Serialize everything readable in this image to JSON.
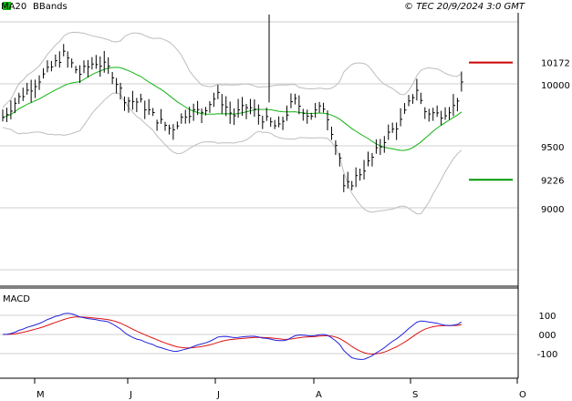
{
  "header": {
    "ma_legend": "MA20",
    "bb_legend": "BBands",
    "copyright": "© TEC 20/9/2024 3:0 GMT"
  },
  "colors": {
    "background": "#ffffff",
    "frame": "#000000",
    "grid": "#cfcfcf",
    "price_bars": "#000000",
    "ma20": "#13b313",
    "bbands": "#bdbdbd",
    "resistance": "#cc0000",
    "support": "#009900",
    "macd_line": "#2222dd",
    "signal_line": "#dd1111"
  },
  "chart_data": [
    {
      "type": "ohlc",
      "panel": "price",
      "title": "",
      "y_ticks": [
        9000,
        9500,
        10000
      ],
      "y_tick_labels": [
        "9000",
        "9500",
        "10000"
      ],
      "x_ticks": [
        "M",
        "J",
        "J",
        "A",
        "S",
        "O"
      ],
      "ylim": [
        8500,
        10960
      ],
      "grid": true,
      "legend": "top-left",
      "levels": [
        {
          "name": "resistance",
          "value": 10172,
          "label": "10172"
        },
        {
          "name": "support",
          "value": 9226,
          "label": "9226"
        }
      ],
      "series": [
        {
          "name": "price",
          "type": "ohlc"
        },
        {
          "name": "MA20",
          "type": "line"
        },
        {
          "name": "BBands",
          "type": "band"
        }
      ]
    },
    {
      "type": "line",
      "panel": "macd",
      "title": "MACD",
      "y_ticks": [
        100,
        0,
        -100
      ],
      "y_tick_labels": [
        "100",
        "000",
        "-100"
      ],
      "ylim": [
        -220,
        200
      ],
      "series": [
        {
          "name": "MACD",
          "color": "macd_line"
        },
        {
          "name": "Signal",
          "color": "signal_line"
        }
      ]
    }
  ]
}
